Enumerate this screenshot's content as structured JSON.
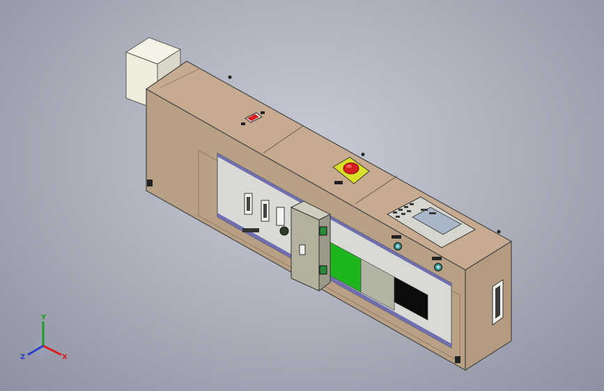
{
  "triad": {
    "x_label": "X",
    "y_label": "Y",
    "z_label": "Z",
    "x_color": "#d62020",
    "y_color": "#1c9a2c",
    "z_color": "#2a3cc8"
  },
  "model": {
    "housing_color": "#c4a78c",
    "top_color": "#c7ab90",
    "side_color": "#b49a80",
    "junction_box_color": "#efeedd",
    "estop_color": "#d81e1e",
    "estop_base_color": "#d8e02a",
    "green_panel_color": "#1fb51f",
    "grey_panel_color": "#b4b4a4",
    "black_panel_color": "#0c0c0c",
    "hmi_screen_color": "#a9b6c8",
    "indicator_color": "#3c8a86"
  },
  "icons": {
    "estop": "emergency-stop-button",
    "hmi": "hmi-keypad-display",
    "indicator": "pilot-light",
    "switch": "rocker-switch",
    "triad": "coordinate-triad"
  }
}
